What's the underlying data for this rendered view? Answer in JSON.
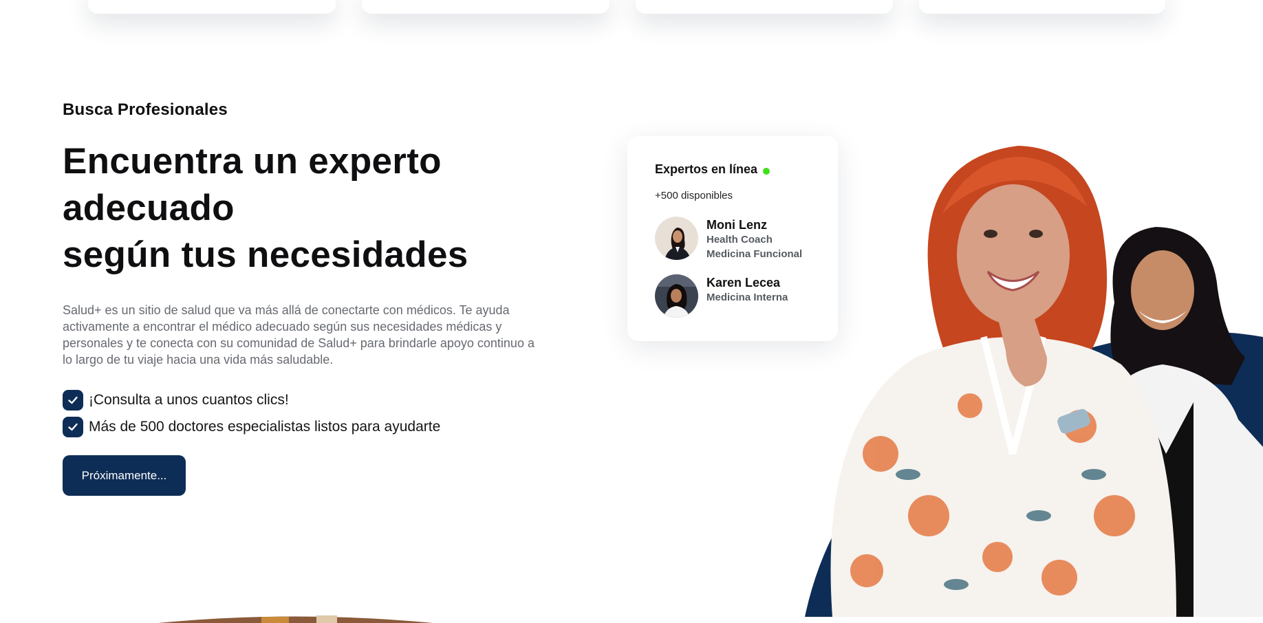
{
  "section": {
    "eyebrow": "Busca Profesionales",
    "headline_line1": "Encuentra un experto adecuado",
    "headline_line2": "según tus necesidades",
    "description": "Salud+ es un sitio de salud que va más allá de conectarte con médicos. Te ayuda activamente a encontrar el médico adecuado según sus necesidades médicas y personales y te conecta con su comunidad de Salud+ para brindarle apoyo continuo a lo largo de tu viaje hacia una vida más saludable.",
    "checks": [
      {
        "icon": "check-icon",
        "text": "¡Consulta a unos cuantos clics!"
      },
      {
        "icon": "check-icon",
        "text": "Más de 500 doctores especialistas listos para ayudarte"
      }
    ],
    "cta_label": "Próximamente..."
  },
  "experts_card": {
    "title": "Expertos en línea",
    "count": "+500 disponibles",
    "experts": [
      {
        "name": "Moni Lenz",
        "role1": "Health Coach",
        "role2": "Medicina Funcional"
      },
      {
        "name": "Karen Lecea",
        "role1": "Medicina Interna",
        "role2": ""
      }
    ]
  },
  "colors": {
    "brand_navy": "#0e2d56",
    "online_green": "#3fe01b",
    "body_text": "#666a70"
  }
}
